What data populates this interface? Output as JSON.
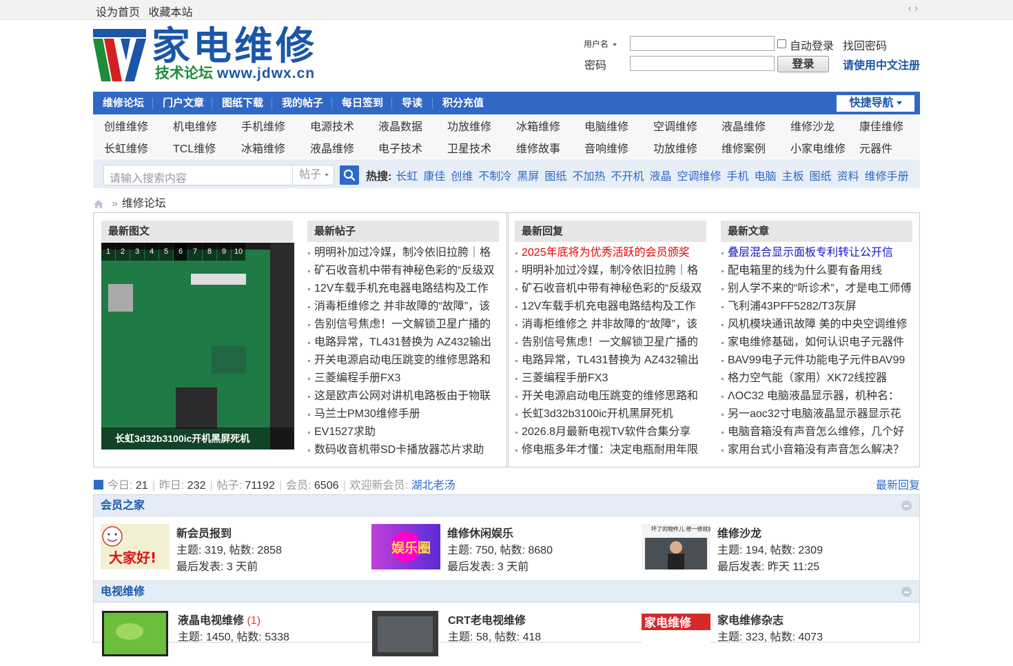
{
  "topbar": {
    "set_home": "设为首页",
    "bookmark": "收藏本站",
    "arrows": "‹ ›"
  },
  "logo": {
    "title": "家电维修",
    "sub_cn": "技术论坛",
    "sub_url": "www.jdwx.cn"
  },
  "login": {
    "username_label": "用户名",
    "password_label": "密码",
    "auto_login": "自动登录",
    "find_password": "找回密码",
    "login_button": "登录",
    "register": "请使用中文注册"
  },
  "nav": {
    "items": [
      "维修论坛",
      "门户文章",
      "图纸下载",
      "我的帖子",
      "每日签到",
      "导读",
      "积分充值"
    ],
    "quick": "快捷导航"
  },
  "subnav": {
    "row1": [
      "创维维修",
      "机电维修",
      "手机维修",
      "电源技术",
      "液晶数据",
      "功放维修",
      "冰箱维修",
      "电脑维修",
      "空调维修",
      "液晶维修",
      "维修沙龙",
      "康佳维修"
    ],
    "row2": [
      "长虹维修",
      "TCL维修",
      "冰箱维修",
      "液晶维修",
      "电子技术",
      "卫星技术",
      "维修故事",
      "音响维修",
      "功放维修",
      "维修案例",
      "小家电维修",
      "元器件"
    ]
  },
  "search": {
    "placeholder": "请输入搜索内容",
    "type": "帖子",
    "hot_label": "热搜:",
    "hot": [
      "长虹",
      "康佳",
      "创维",
      "不制冷",
      "黑屏",
      "图纸",
      "不加热",
      "不开机",
      "液晶",
      "空调维修",
      "手机",
      "电脑",
      "主板",
      "图纸",
      "资料",
      "维修手册"
    ]
  },
  "breadcrumb": {
    "sep": "»",
    "current": "维修论坛"
  },
  "portal": {
    "pics": {
      "title": "最新图文",
      "numbers": [
        "1",
        "2",
        "3",
        "4",
        "5",
        "6",
        "7",
        "8",
        "9",
        "10"
      ],
      "caption": "长虹3d32b3100ic开机黑屏死机"
    },
    "posts": {
      "title": "最新帖子",
      "items": [
        "明明补加过冷媒，制冷依旧拉胯｜格",
        "矿石收音机中带有神秘色彩的“反级双",
        "12V车载手机充电器电路结构及工作",
        "消毒柜维修之 并非故障的“故障”，该",
        "告别信号焦虑！一文解锁卫星广播的",
        "电路异常，TL431替换为 AZ432输出",
        "开关电源启动电压跳变的维修思路和",
        "三菱编程手册FX3",
        "这是欧声公网对讲机电路板由于物联",
        "马兰士PM30维修手册",
        "EV1527求助",
        "数码收音机带SD卡播放器芯片求助"
      ]
    },
    "replies": {
      "title": "最新回复",
      "items": [
        "2025年底将为优秀活跃的会员颁奖",
        "明明补加过冷媒，制冷依旧拉胯｜格",
        "矿石收音机中带有神秘色彩的“反级双",
        "12V车载手机充电器电路结构及工作",
        "消毒柜维修之 并非故障的“故障”，该",
        "告别信号焦虑！一文解锁卫星广播的",
        "电路异常，TL431替换为 AZ432输出",
        "三菱编程手册FX3",
        "开关电源启动电压跳变的维修思路和",
        "长虹3d32b3100ic开机黑屏死机",
        "2026.8月最新电视TV软件合集分享",
        "修电瓶多年才懂：决定电瓶耐用年限"
      ]
    },
    "articles": {
      "title": "最新文章",
      "items": [
        "叠层混合显示面板专利转让公开信",
        "配电箱里的线为什么要有备用线",
        "别人学不来的“听诊术”，才是电工师傅",
        "飞利浦43PFF5282/T3灰屏",
        "风机模块通讯故障 美的中央空调维修",
        "家电维修基础，如何认识电子元器件",
        "BAV99电子元件功能电子元件BAV99",
        "格力空气能（家用）XK72线控器",
        "ΛOC32 电脑液晶显示器，机种名：",
        "另一aoc32寸电脑液晶显示器显示花",
        "电脑音箱没有声音怎么维修，几个好",
        "家用台式小音箱没有声音怎么解决？"
      ]
    }
  },
  "stats": {
    "today_label": "今日:",
    "today": "21",
    "yesterday_label": "昨日:",
    "yesterday": "232",
    "posts_label": "帖子:",
    "posts": "71192",
    "members_label": "会员:",
    "members": "6506",
    "welcome_label": "欢迎新会员:",
    "new_member": "湖北老汤",
    "new_reply": "最新回复"
  },
  "categories": [
    {
      "name": "会员之家",
      "forums": [
        {
          "name": "新会员报到",
          "today": "",
          "stats": "主题: 319, 帖数: 2858",
          "last": "最后发表: 3 天前",
          "img_text": "大家好!"
        },
        {
          "name": "维修休闲娱乐",
          "today": "",
          "stats": "主题: 750, 帖数: 8680",
          "last": "最后发表: 3 天前",
          "img_text": "娱乐圈"
        },
        {
          "name": "维修沙龙",
          "today": "",
          "stats": "主题: 194, 帖数: 2309",
          "last": "最后发表: 昨天 11:25",
          "img_text": "坏了的物件儿 修一修就好"
        }
      ]
    },
    {
      "name": "电视维修",
      "forums": [
        {
          "name": "液晶电视维修",
          "today": "(1)",
          "stats": "主题: 1450, 帖数: 5338",
          "last": "",
          "img_text": ""
        },
        {
          "name": "CRT老电视维修",
          "today": "",
          "stats": "主题: 58, 帖数: 418",
          "last": "",
          "img_text": ""
        },
        {
          "name": "家电维修杂志",
          "today": "",
          "stats": "主题: 323, 帖数: 4073",
          "last": "",
          "img_text": "家电维修"
        }
      ]
    }
  ]
}
